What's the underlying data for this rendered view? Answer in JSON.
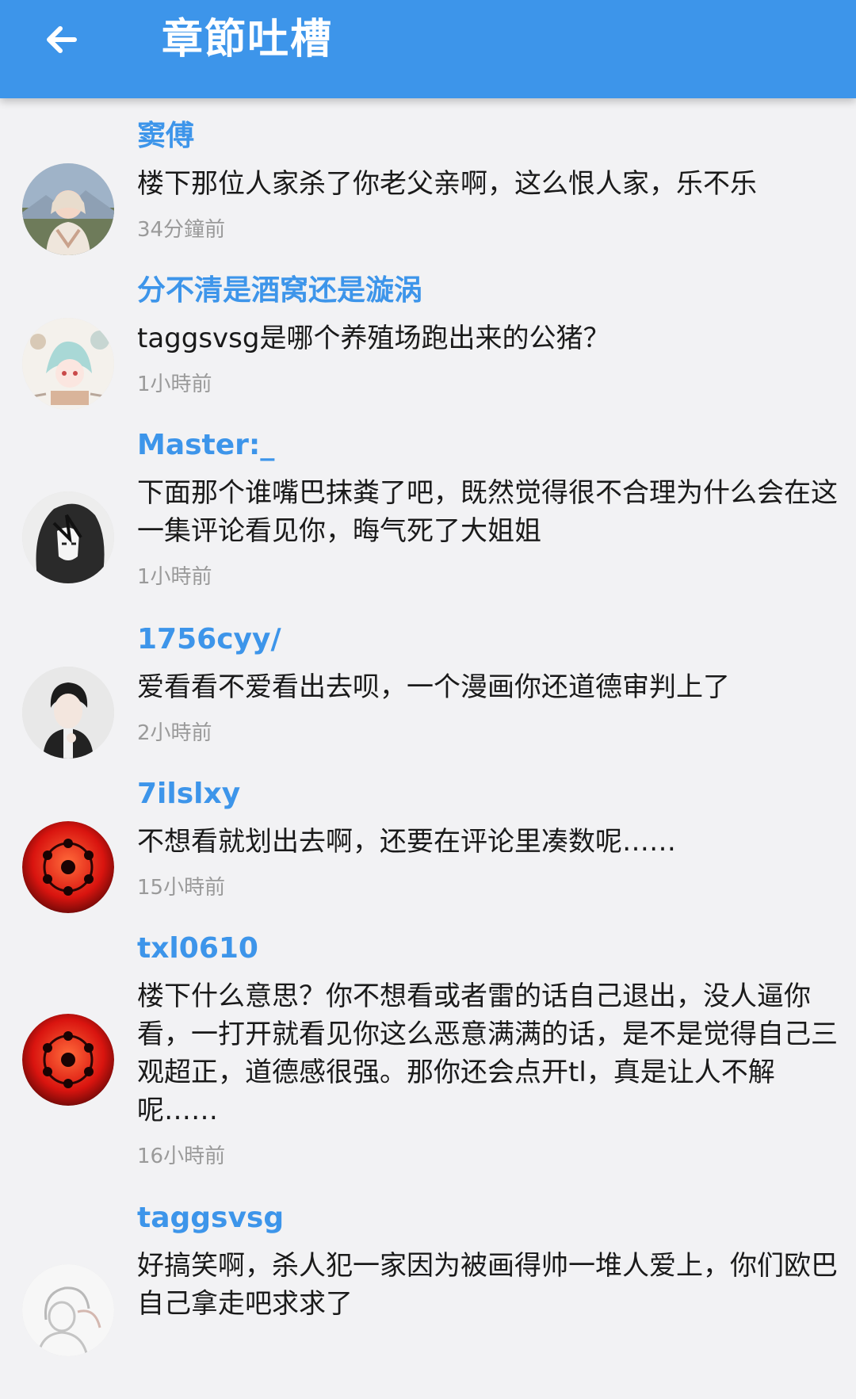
{
  "app_bar": {
    "title": "章節吐槽",
    "back_icon": "arrow-left-icon"
  },
  "colors": {
    "primary": "#3d95ea",
    "background": "#f2f2f4",
    "text": "#1a1a1a",
    "timestamp": "#9a9a9a"
  },
  "comments": [
    {
      "username": "窦傅",
      "content": "楼下那位人家杀了你老父亲啊，这么恨人家，乐不乐",
      "time": "34分鐘前"
    },
    {
      "username": "分不清是酒窝还是漩涡",
      "content": "taggsvsg是哪个养殖场跑出来的公猪？",
      "time": "1小時前"
    },
    {
      "username": "Master:_",
      "content": "下面那个谁嘴巴抹粪了吧，既然觉得很不合理为什么会在这一集评论看见你，晦气死了大姐姐",
      "time": "1小時前"
    },
    {
      "username": "1756cyy/",
      "content": "爱看看不爱看出去呗，一个漫画你还道德审判上了",
      "time": "2小時前"
    },
    {
      "username": "7ilslxy",
      "content": "不想看就划出去啊，还要在评论里凑数呢……",
      "time": "15小時前"
    },
    {
      "username": "txl0610",
      "content": "楼下什么意思？你不想看或者雷的话自己退出，没人逼你看，一打开就看见你这么恶意满满的话，是不是觉得自己三观超正，道德感很强。那你还会点开tl，真是让人不解呢……",
      "time": "16小時前"
    },
    {
      "username": "taggsvsg",
      "content": "好搞笑啊，杀人犯一家因为被画得帅一堆人爱上，你们欧巴自己拿走吧求求了",
      "time": ""
    }
  ]
}
